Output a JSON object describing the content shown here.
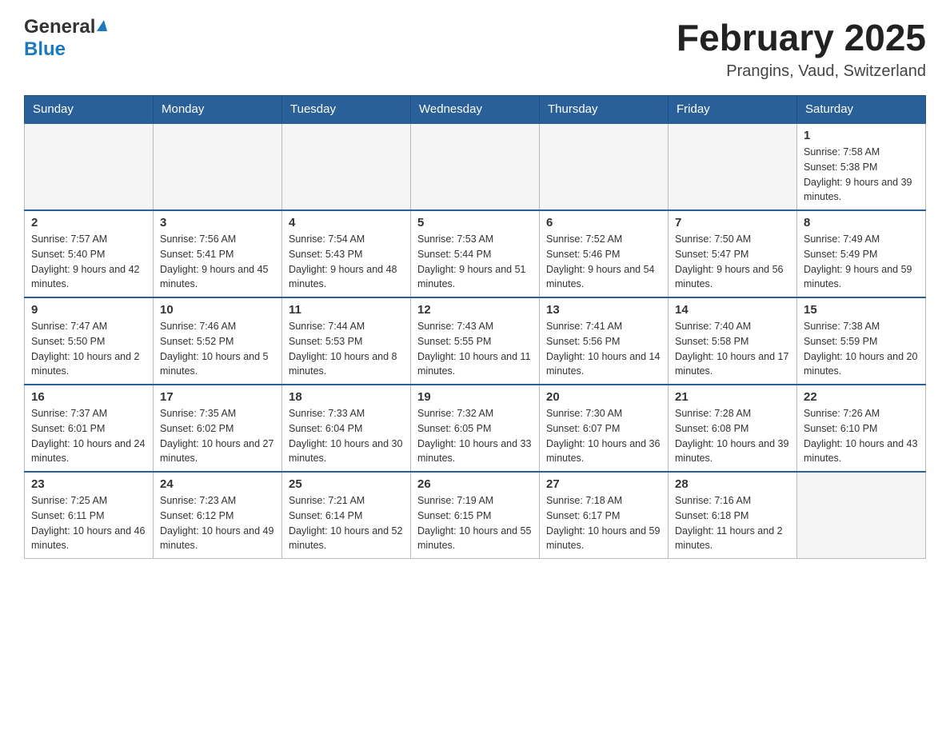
{
  "header": {
    "logo_line1": "General",
    "logo_line2": "Blue",
    "title": "February 2025",
    "subtitle": "Prangins, Vaud, Switzerland"
  },
  "days_of_week": [
    "Sunday",
    "Monday",
    "Tuesday",
    "Wednesday",
    "Thursday",
    "Friday",
    "Saturday"
  ],
  "weeks": [
    {
      "days": [
        {
          "num": "",
          "sunrise": "",
          "sunset": "",
          "daylight": ""
        },
        {
          "num": "",
          "sunrise": "",
          "sunset": "",
          "daylight": ""
        },
        {
          "num": "",
          "sunrise": "",
          "sunset": "",
          "daylight": ""
        },
        {
          "num": "",
          "sunrise": "",
          "sunset": "",
          "daylight": ""
        },
        {
          "num": "",
          "sunrise": "",
          "sunset": "",
          "daylight": ""
        },
        {
          "num": "",
          "sunrise": "",
          "sunset": "",
          "daylight": ""
        },
        {
          "num": "1",
          "sunrise": "Sunrise: 7:58 AM",
          "sunset": "Sunset: 5:38 PM",
          "daylight": "Daylight: 9 hours and 39 minutes."
        }
      ]
    },
    {
      "days": [
        {
          "num": "2",
          "sunrise": "Sunrise: 7:57 AM",
          "sunset": "Sunset: 5:40 PM",
          "daylight": "Daylight: 9 hours and 42 minutes."
        },
        {
          "num": "3",
          "sunrise": "Sunrise: 7:56 AM",
          "sunset": "Sunset: 5:41 PM",
          "daylight": "Daylight: 9 hours and 45 minutes."
        },
        {
          "num": "4",
          "sunrise": "Sunrise: 7:54 AM",
          "sunset": "Sunset: 5:43 PM",
          "daylight": "Daylight: 9 hours and 48 minutes."
        },
        {
          "num": "5",
          "sunrise": "Sunrise: 7:53 AM",
          "sunset": "Sunset: 5:44 PM",
          "daylight": "Daylight: 9 hours and 51 minutes."
        },
        {
          "num": "6",
          "sunrise": "Sunrise: 7:52 AM",
          "sunset": "Sunset: 5:46 PM",
          "daylight": "Daylight: 9 hours and 54 minutes."
        },
        {
          "num": "7",
          "sunrise": "Sunrise: 7:50 AM",
          "sunset": "Sunset: 5:47 PM",
          "daylight": "Daylight: 9 hours and 56 minutes."
        },
        {
          "num": "8",
          "sunrise": "Sunrise: 7:49 AM",
          "sunset": "Sunset: 5:49 PM",
          "daylight": "Daylight: 9 hours and 59 minutes."
        }
      ]
    },
    {
      "days": [
        {
          "num": "9",
          "sunrise": "Sunrise: 7:47 AM",
          "sunset": "Sunset: 5:50 PM",
          "daylight": "Daylight: 10 hours and 2 minutes."
        },
        {
          "num": "10",
          "sunrise": "Sunrise: 7:46 AM",
          "sunset": "Sunset: 5:52 PM",
          "daylight": "Daylight: 10 hours and 5 minutes."
        },
        {
          "num": "11",
          "sunrise": "Sunrise: 7:44 AM",
          "sunset": "Sunset: 5:53 PM",
          "daylight": "Daylight: 10 hours and 8 minutes."
        },
        {
          "num": "12",
          "sunrise": "Sunrise: 7:43 AM",
          "sunset": "Sunset: 5:55 PM",
          "daylight": "Daylight: 10 hours and 11 minutes."
        },
        {
          "num": "13",
          "sunrise": "Sunrise: 7:41 AM",
          "sunset": "Sunset: 5:56 PM",
          "daylight": "Daylight: 10 hours and 14 minutes."
        },
        {
          "num": "14",
          "sunrise": "Sunrise: 7:40 AM",
          "sunset": "Sunset: 5:58 PM",
          "daylight": "Daylight: 10 hours and 17 minutes."
        },
        {
          "num": "15",
          "sunrise": "Sunrise: 7:38 AM",
          "sunset": "Sunset: 5:59 PM",
          "daylight": "Daylight: 10 hours and 20 minutes."
        }
      ]
    },
    {
      "days": [
        {
          "num": "16",
          "sunrise": "Sunrise: 7:37 AM",
          "sunset": "Sunset: 6:01 PM",
          "daylight": "Daylight: 10 hours and 24 minutes."
        },
        {
          "num": "17",
          "sunrise": "Sunrise: 7:35 AM",
          "sunset": "Sunset: 6:02 PM",
          "daylight": "Daylight: 10 hours and 27 minutes."
        },
        {
          "num": "18",
          "sunrise": "Sunrise: 7:33 AM",
          "sunset": "Sunset: 6:04 PM",
          "daylight": "Daylight: 10 hours and 30 minutes."
        },
        {
          "num": "19",
          "sunrise": "Sunrise: 7:32 AM",
          "sunset": "Sunset: 6:05 PM",
          "daylight": "Daylight: 10 hours and 33 minutes."
        },
        {
          "num": "20",
          "sunrise": "Sunrise: 7:30 AM",
          "sunset": "Sunset: 6:07 PM",
          "daylight": "Daylight: 10 hours and 36 minutes."
        },
        {
          "num": "21",
          "sunrise": "Sunrise: 7:28 AM",
          "sunset": "Sunset: 6:08 PM",
          "daylight": "Daylight: 10 hours and 39 minutes."
        },
        {
          "num": "22",
          "sunrise": "Sunrise: 7:26 AM",
          "sunset": "Sunset: 6:10 PM",
          "daylight": "Daylight: 10 hours and 43 minutes."
        }
      ]
    },
    {
      "days": [
        {
          "num": "23",
          "sunrise": "Sunrise: 7:25 AM",
          "sunset": "Sunset: 6:11 PM",
          "daylight": "Daylight: 10 hours and 46 minutes."
        },
        {
          "num": "24",
          "sunrise": "Sunrise: 7:23 AM",
          "sunset": "Sunset: 6:12 PM",
          "daylight": "Daylight: 10 hours and 49 minutes."
        },
        {
          "num": "25",
          "sunrise": "Sunrise: 7:21 AM",
          "sunset": "Sunset: 6:14 PM",
          "daylight": "Daylight: 10 hours and 52 minutes."
        },
        {
          "num": "26",
          "sunrise": "Sunrise: 7:19 AM",
          "sunset": "Sunset: 6:15 PM",
          "daylight": "Daylight: 10 hours and 55 minutes."
        },
        {
          "num": "27",
          "sunrise": "Sunrise: 7:18 AM",
          "sunset": "Sunset: 6:17 PM",
          "daylight": "Daylight: 10 hours and 59 minutes."
        },
        {
          "num": "28",
          "sunrise": "Sunrise: 7:16 AM",
          "sunset": "Sunset: 6:18 PM",
          "daylight": "Daylight: 11 hours and 2 minutes."
        },
        {
          "num": "",
          "sunrise": "",
          "sunset": "",
          "daylight": ""
        }
      ]
    }
  ]
}
